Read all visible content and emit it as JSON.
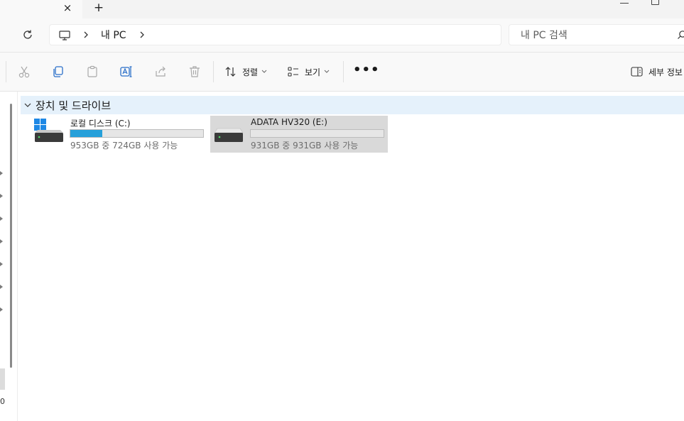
{
  "tabs": {
    "close_glyph": "×",
    "new_tab_glyph": "+"
  },
  "address": {
    "breadcrumb": "내 PC"
  },
  "search": {
    "placeholder": "내 PC 검색"
  },
  "toolbar": {
    "sort_label": "정렬",
    "view_label": "보기",
    "more_label": "•••",
    "details_label": "세부 정보"
  },
  "icons": [
    "close-icon",
    "plus-icon",
    "minimize-icon",
    "maximize-icon",
    "refresh-icon",
    "computer-icon",
    "chevron-right-icon",
    "search-icon",
    "cut-icon",
    "copy-icon",
    "paste-icon",
    "rename-icon",
    "share-icon",
    "delete-icon",
    "sort-icon",
    "view-icon",
    "more-icon",
    "details-pane-icon",
    "chevron-down-icon",
    "windows-drive-icon",
    "drive-icon"
  ],
  "nav": {
    "fragment": "0"
  },
  "content": {
    "group": {
      "label": "장치 및 드라이브"
    },
    "drives": [
      {
        "name": "로컬 디스크 (C:)",
        "space": "953GB 중 724GB 사용 가능",
        "used_fraction": 0.24,
        "color": "#26a0da",
        "selected": false
      },
      {
        "name": "ADATA HV320 (E:)",
        "space": "931GB 중 931GB 사용 가능",
        "used_fraction": 0.0,
        "color": "#26a0da",
        "selected": true
      }
    ]
  },
  "colors": {
    "accent": "#26a0da",
    "group_bg": "#e5f1fb",
    "selection": "#d9d9d9"
  }
}
